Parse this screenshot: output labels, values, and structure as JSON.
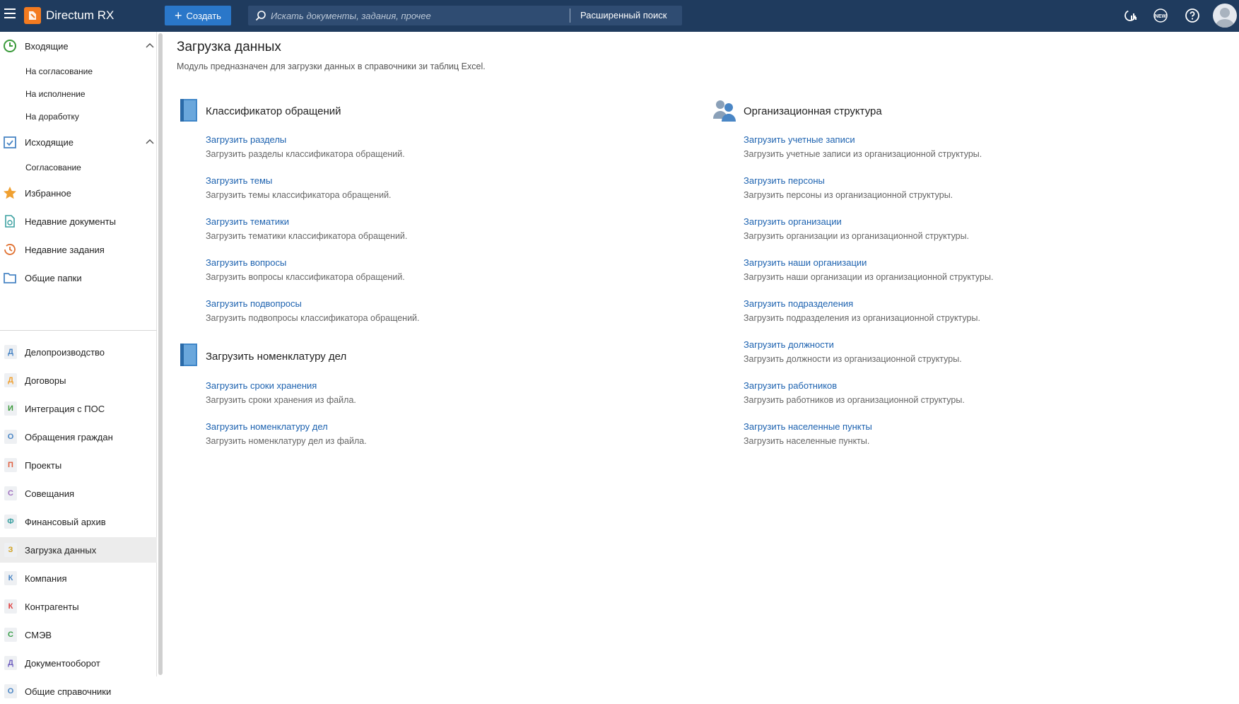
{
  "topbar": {
    "app_title": "Directum RX",
    "create_label": "Создать",
    "search_placeholder": "Искать документы, задания, прочее",
    "advanced_search": "Расширенный поиск"
  },
  "sidebar": {
    "incoming": {
      "label": "Входящие",
      "children": [
        "На согласование",
        "На исполнение",
        "На доработку"
      ]
    },
    "outgoing": {
      "label": "Исходящие",
      "children": [
        "Согласование"
      ]
    },
    "favorites": "Избранное",
    "recent_docs": "Недавние документы",
    "recent_tasks": "Недавние задания",
    "shared_folders": "Общие папки",
    "modules": [
      {
        "letter": "Д",
        "label": "Делопроизводство",
        "color": "#4a86c5"
      },
      {
        "letter": "Д",
        "label": "Договоры",
        "color": "#f0a030"
      },
      {
        "letter": "И",
        "label": "Интеграция с ПОС",
        "color": "#3a9a3a"
      },
      {
        "letter": "О",
        "label": "Обращения граждан",
        "color": "#4a86c5"
      },
      {
        "letter": "П",
        "label": "Проекты",
        "color": "#e06040"
      },
      {
        "letter": "С",
        "label": "Совещания",
        "color": "#a070c0"
      },
      {
        "letter": "Ф",
        "label": "Финансовый архив",
        "color": "#3aa0a0"
      },
      {
        "letter": "З",
        "label": "Загрузка данных",
        "color": "#d0a020"
      },
      {
        "letter": "К",
        "label": "Компания",
        "color": "#4a86c5"
      },
      {
        "letter": "К",
        "label": "Контрагенты",
        "color": "#e04040"
      },
      {
        "letter": "С",
        "label": "СМЭВ",
        "color": "#3aa04a"
      },
      {
        "letter": "Д",
        "label": "Документооборот",
        "color": "#7060c0"
      },
      {
        "letter": "О",
        "label": "Общие справочники",
        "color": "#4a86c5"
      }
    ]
  },
  "page": {
    "title": "Загрузка данных",
    "subtitle": "Модуль предназначен для загрузки данных в справочники зи таблиц Excel."
  },
  "sections": {
    "classifier": {
      "title": "Классификатор обращений",
      "items": [
        {
          "link": "Загрузить разделы",
          "desc": "Загрузить разделы классификатора обращений."
        },
        {
          "link": "Загрузить темы",
          "desc": "Загрузить темы классификатора обращений."
        },
        {
          "link": "Загрузить тематики",
          "desc": "Загрузить тематики классификатора обращений."
        },
        {
          "link": "Загрузить вопросы",
          "desc": "Загрузить вопросы классификатора обращений."
        },
        {
          "link": "Загрузить подвопросы",
          "desc": "Загрузить подвопросы классификатора обращений."
        }
      ]
    },
    "nomenclature": {
      "title": "Загрузить номенклатуру дел",
      "items": [
        {
          "link": "Загрузить сроки хранения",
          "desc": "Загрузить сроки хранения из файла."
        },
        {
          "link": "Загрузить номенклатуру дел",
          "desc": "Загрузить номенклатуру дел из файла."
        }
      ]
    },
    "org": {
      "title": "Организационная структура",
      "items": [
        {
          "link": "Загрузить учетные записи",
          "desc": "Загрузить учетные записи из организационной структуры."
        },
        {
          "link": "Загрузить персоны",
          "desc": "Загрузить персоны из организационной структуры."
        },
        {
          "link": "Загрузить организации",
          "desc": "Загрузить организации из организационной структуры."
        },
        {
          "link": "Загрузить наши организации",
          "desc": "Загрузить наши организации из организационной структуры."
        },
        {
          "link": "Загрузить подразделения",
          "desc": "Загрузить подразделения из организационной структуры."
        },
        {
          "link": "Загрузить должности",
          "desc": "Загрузить должности из организационной структуры."
        },
        {
          "link": "Загрузить работников",
          "desc": "Загрузить работников из организационной структуры."
        },
        {
          "link": "Загрузить населенные пункты",
          "desc": "Загрузить населенные пункты."
        }
      ]
    }
  }
}
